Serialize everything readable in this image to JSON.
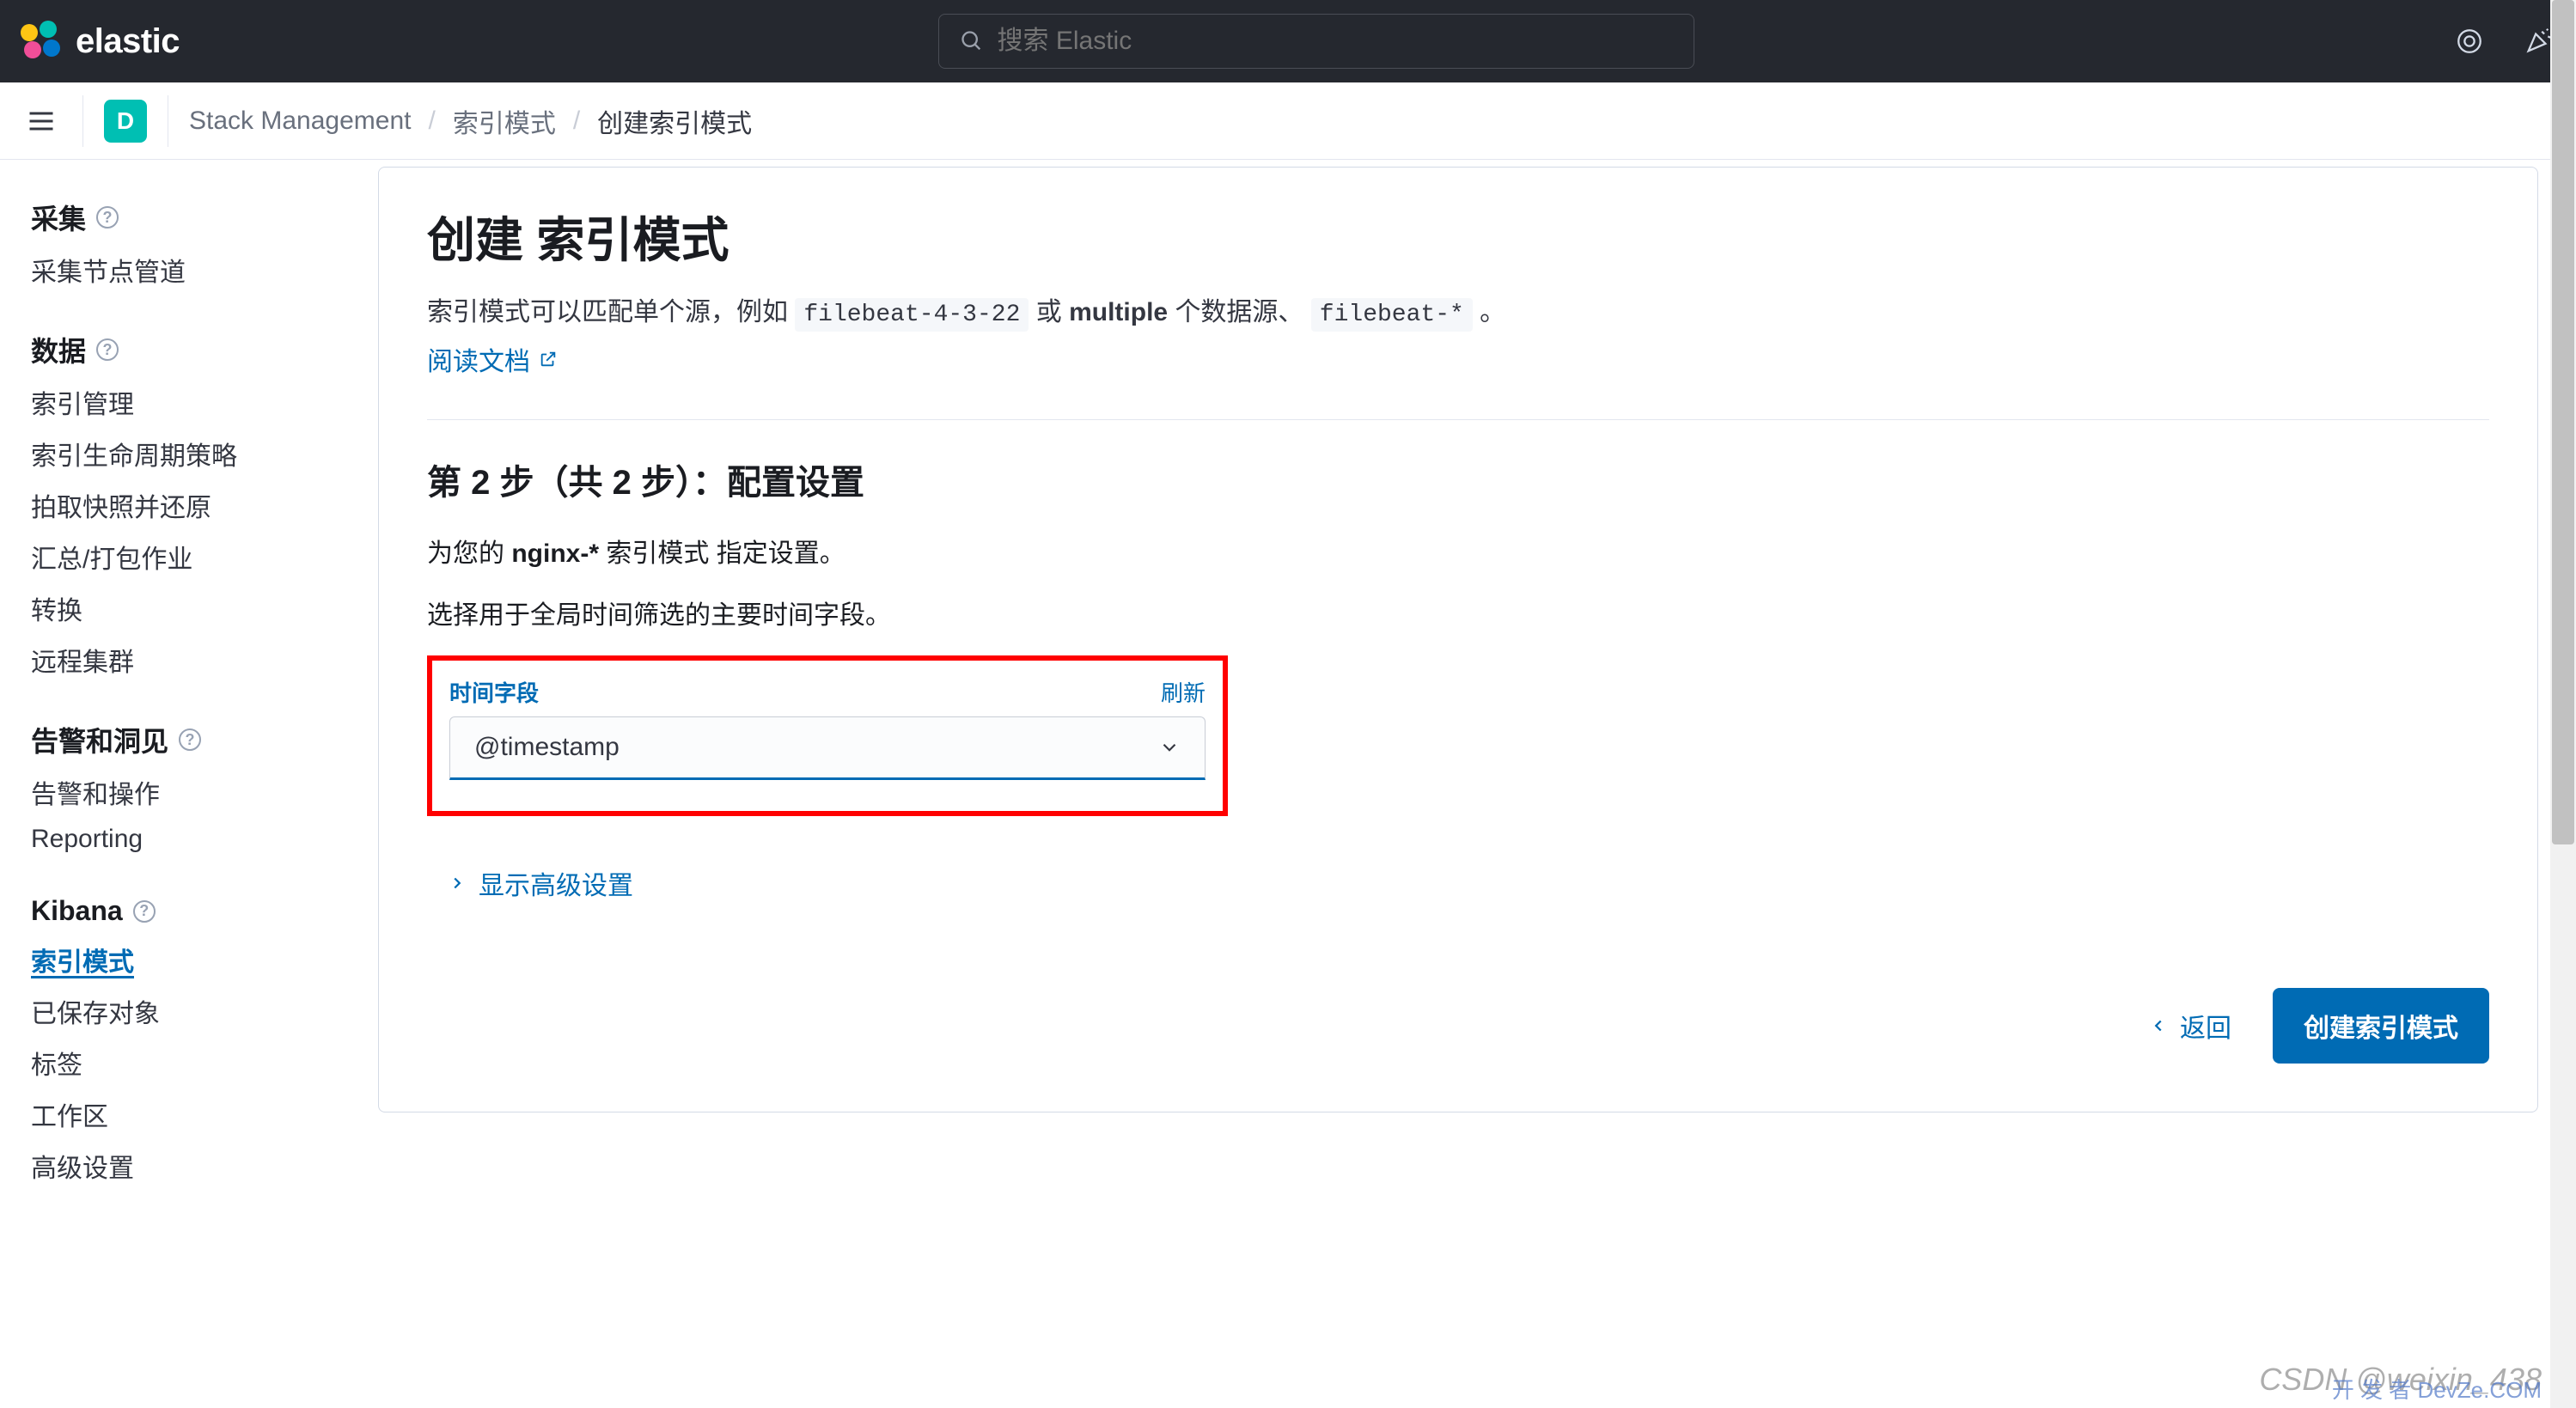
{
  "header": {
    "brand": "elastic",
    "search_placeholder": "搜索 Elastic",
    "space_badge": "D"
  },
  "breadcrumbs": {
    "root": "Stack Management",
    "level1": "索引模式",
    "current": "创建索引模式"
  },
  "sidebar": {
    "sections": [
      {
        "title": "采集",
        "links": [
          "采集节点管道"
        ]
      },
      {
        "title": "数据",
        "links": [
          "索引管理",
          "索引生命周期策略",
          "拍取快照并还原",
          "汇总/打包作业",
          "转换",
          "远程集群"
        ]
      },
      {
        "title": "告警和洞见",
        "links": [
          "告警和操作",
          "Reporting"
        ]
      },
      {
        "title": "Kibana",
        "links": [
          "索引模式",
          "已保存对象",
          "标签",
          "工作区",
          "高级设置"
        ],
        "active_index": 0
      }
    ]
  },
  "main": {
    "title": "创建 索引模式",
    "desc_prefix": "索引模式可以匹配单个源，例如 ",
    "desc_code1": "filebeat-4-3-22",
    "desc_mid": " 或 ",
    "desc_bold": "multiple",
    "desc_mid2": " 个数据源、 ",
    "desc_code2": "filebeat-*",
    "desc_suffix": " 。",
    "read_docs": "阅读文档",
    "step_title": "第 2 步（共 2 步）：配置设置",
    "form_line1_pre": "为您的 ",
    "form_line1_bold": "nginx-*",
    "form_line1_post": " 索引模式 指定设置。",
    "form_line2": "选择用于全局时间筛选的主要时间字段。",
    "field_label": "时间字段",
    "refresh": "刷新",
    "select_value": "@timestamp",
    "advanced": "显示高级设置",
    "back": "返回",
    "submit": "创建索引模式"
  },
  "watermark": "CSDN @weixin_438",
  "watermark2": "开 发 者\nDevZe.COM"
}
